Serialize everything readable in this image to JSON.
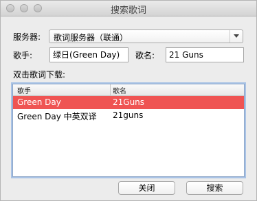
{
  "window": {
    "title": "搜索歌词"
  },
  "form": {
    "server_label": "服务器:",
    "server_value": "歌词服务器（联通）",
    "artist_label": "歌手:",
    "artist_value": "绿日(Green Day)",
    "song_label": "歌名:",
    "song_value": "21 Guns",
    "hint": "双击歌词下载:"
  },
  "table": {
    "columns": [
      "歌手",
      "歌名"
    ],
    "rows": [
      {
        "artist": "Green Day",
        "song": "21Guns",
        "selected": true
      },
      {
        "artist": "Green Day 中英双译",
        "song": "21guns",
        "selected": false
      }
    ]
  },
  "buttons": {
    "close": "关闭",
    "search": "搜索"
  },
  "colors": {
    "selection": "#ef5453",
    "focus_ring": "#a9c3e6"
  },
  "icons": {
    "dropdown": "chevron-down-icon"
  }
}
